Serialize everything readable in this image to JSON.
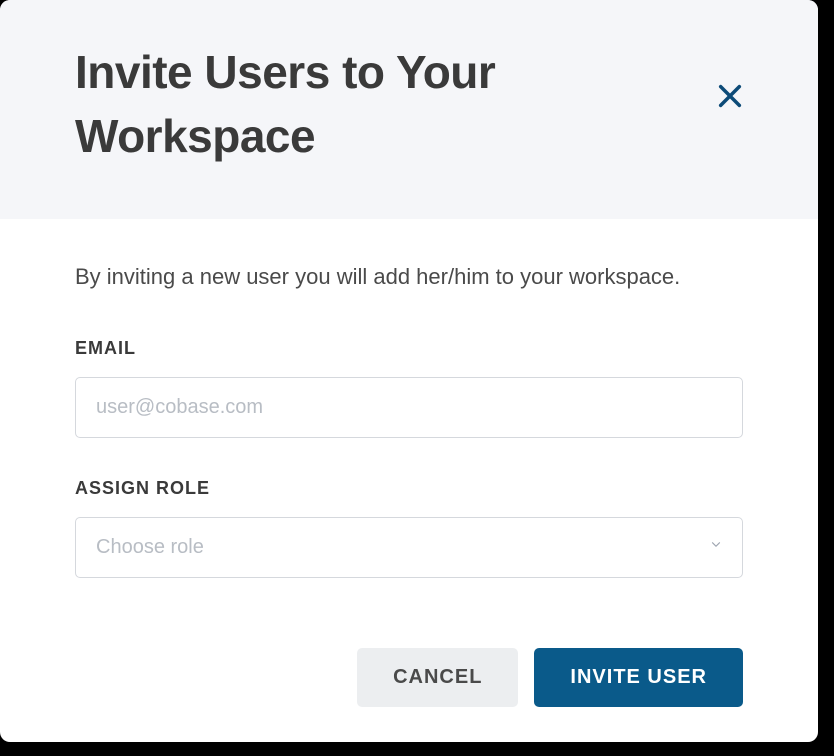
{
  "modal": {
    "title": "Invite Users to Your Workspace",
    "description": "By inviting a new user you will add her/him to your workspace."
  },
  "form": {
    "email": {
      "label": "EMAIL",
      "placeholder": "user@cobase.com",
      "value": ""
    },
    "role": {
      "label": "ASSIGN ROLE",
      "placeholder": "Choose role"
    }
  },
  "buttons": {
    "cancel": "CANCEL",
    "invite": "INVITE USER"
  },
  "colors": {
    "primary": "#0a5a8a",
    "closeIcon": "#0d4b78"
  }
}
